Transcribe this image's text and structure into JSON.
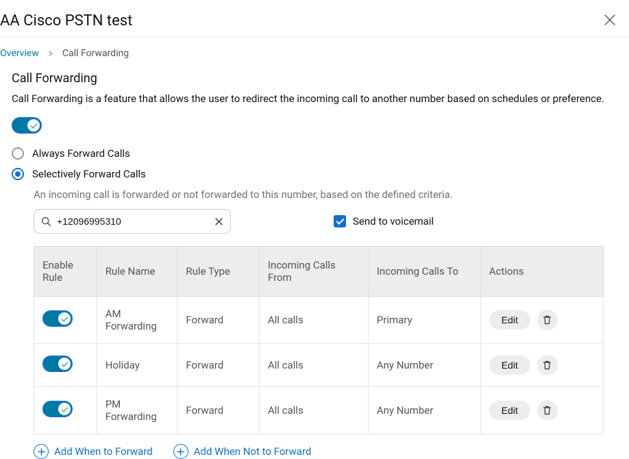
{
  "header": {
    "title": "AA Cisco PSTN test"
  },
  "breadcrumb": {
    "link": "Overview",
    "current": "Call Forwarding"
  },
  "section": {
    "title": "Call Forwarding",
    "description": "Call Forwarding is a feature that allows the user to redirect the incoming call to another number based on schedules or preference."
  },
  "radios": {
    "always_label": "Always Forward Calls",
    "selective_label": "Selectively Forward Calls"
  },
  "selective": {
    "description": "An incoming call is forwarded or not forwarded to this number, based on the defined criteria.",
    "phone": "+12096995310",
    "voicemail_label": "Send to voicemail"
  },
  "table": {
    "headers": {
      "enable": "Enable Rule",
      "name": "Rule Name",
      "type": "Rule Type",
      "from": "Incoming Calls From",
      "to": "Incoming Calls To",
      "actions": "Actions"
    },
    "rows": [
      {
        "name": "AM Forwarding",
        "type": "Forward",
        "from": "All calls",
        "to": "Primary",
        "edit": "Edit"
      },
      {
        "name": "Holiday",
        "type": "Forward",
        "from": "All calls",
        "to": "Any Number",
        "edit": "Edit"
      },
      {
        "name": "PM Forwarding",
        "type": "Forward",
        "from": "All calls",
        "to": "Any Number",
        "edit": "Edit"
      }
    ]
  },
  "footer": {
    "add_when": "Add When to Forward",
    "add_when_not": "Add When Not to Forward"
  }
}
